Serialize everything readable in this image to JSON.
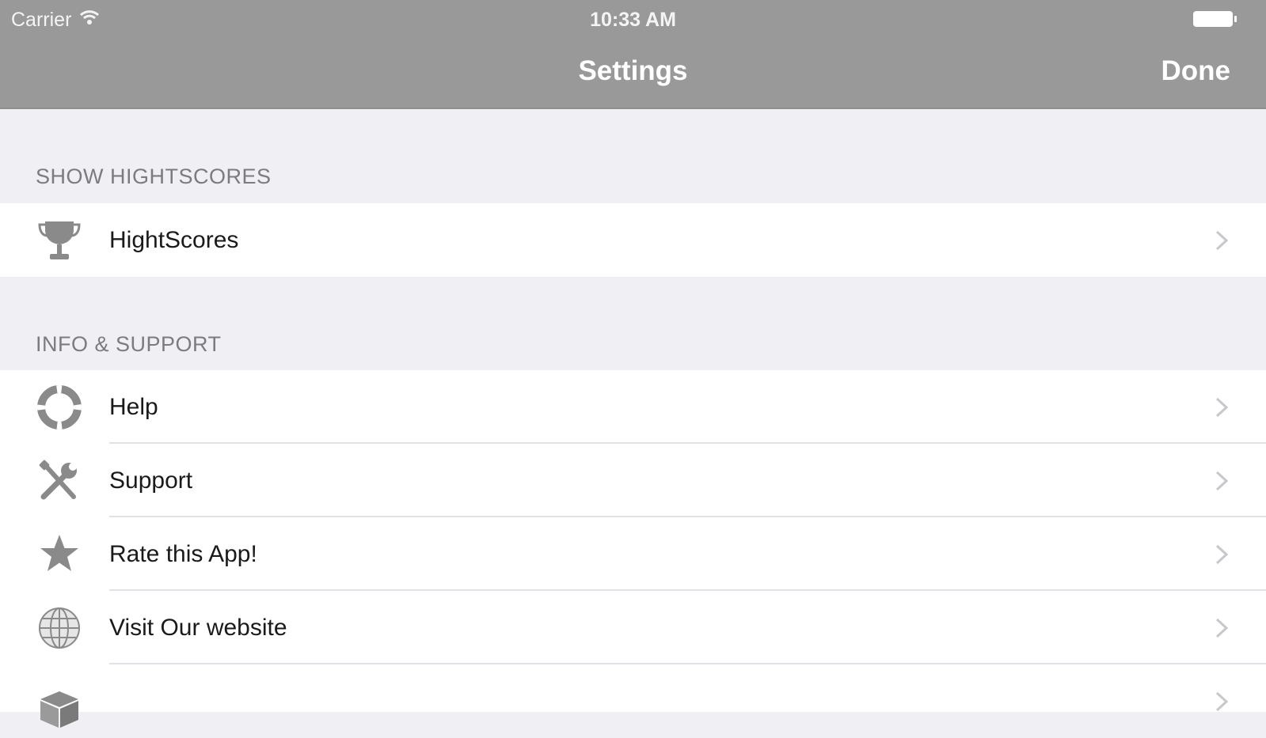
{
  "status_bar": {
    "carrier": "Carrier",
    "time": "10:33 AM"
  },
  "nav": {
    "title": "Settings",
    "done_label": "Done"
  },
  "sections": [
    {
      "header": "SHOW HIGHTSCORES",
      "items": [
        {
          "label": "HightScores",
          "icon": "trophy-icon"
        }
      ]
    },
    {
      "header": "INFO & SUPPORT",
      "items": [
        {
          "label": "Help",
          "icon": "lifebuoy-icon"
        },
        {
          "label": "Support",
          "icon": "tools-icon"
        },
        {
          "label": "Rate this App!",
          "icon": "star-icon"
        },
        {
          "label": "Visit Our website",
          "icon": "globe-icon"
        },
        {
          "label": "",
          "icon": "box-icon"
        }
      ]
    }
  ],
  "colors": {
    "nav_background": "#999999",
    "page_background": "#efeff4",
    "icon_gray": "#8a8a8a"
  }
}
